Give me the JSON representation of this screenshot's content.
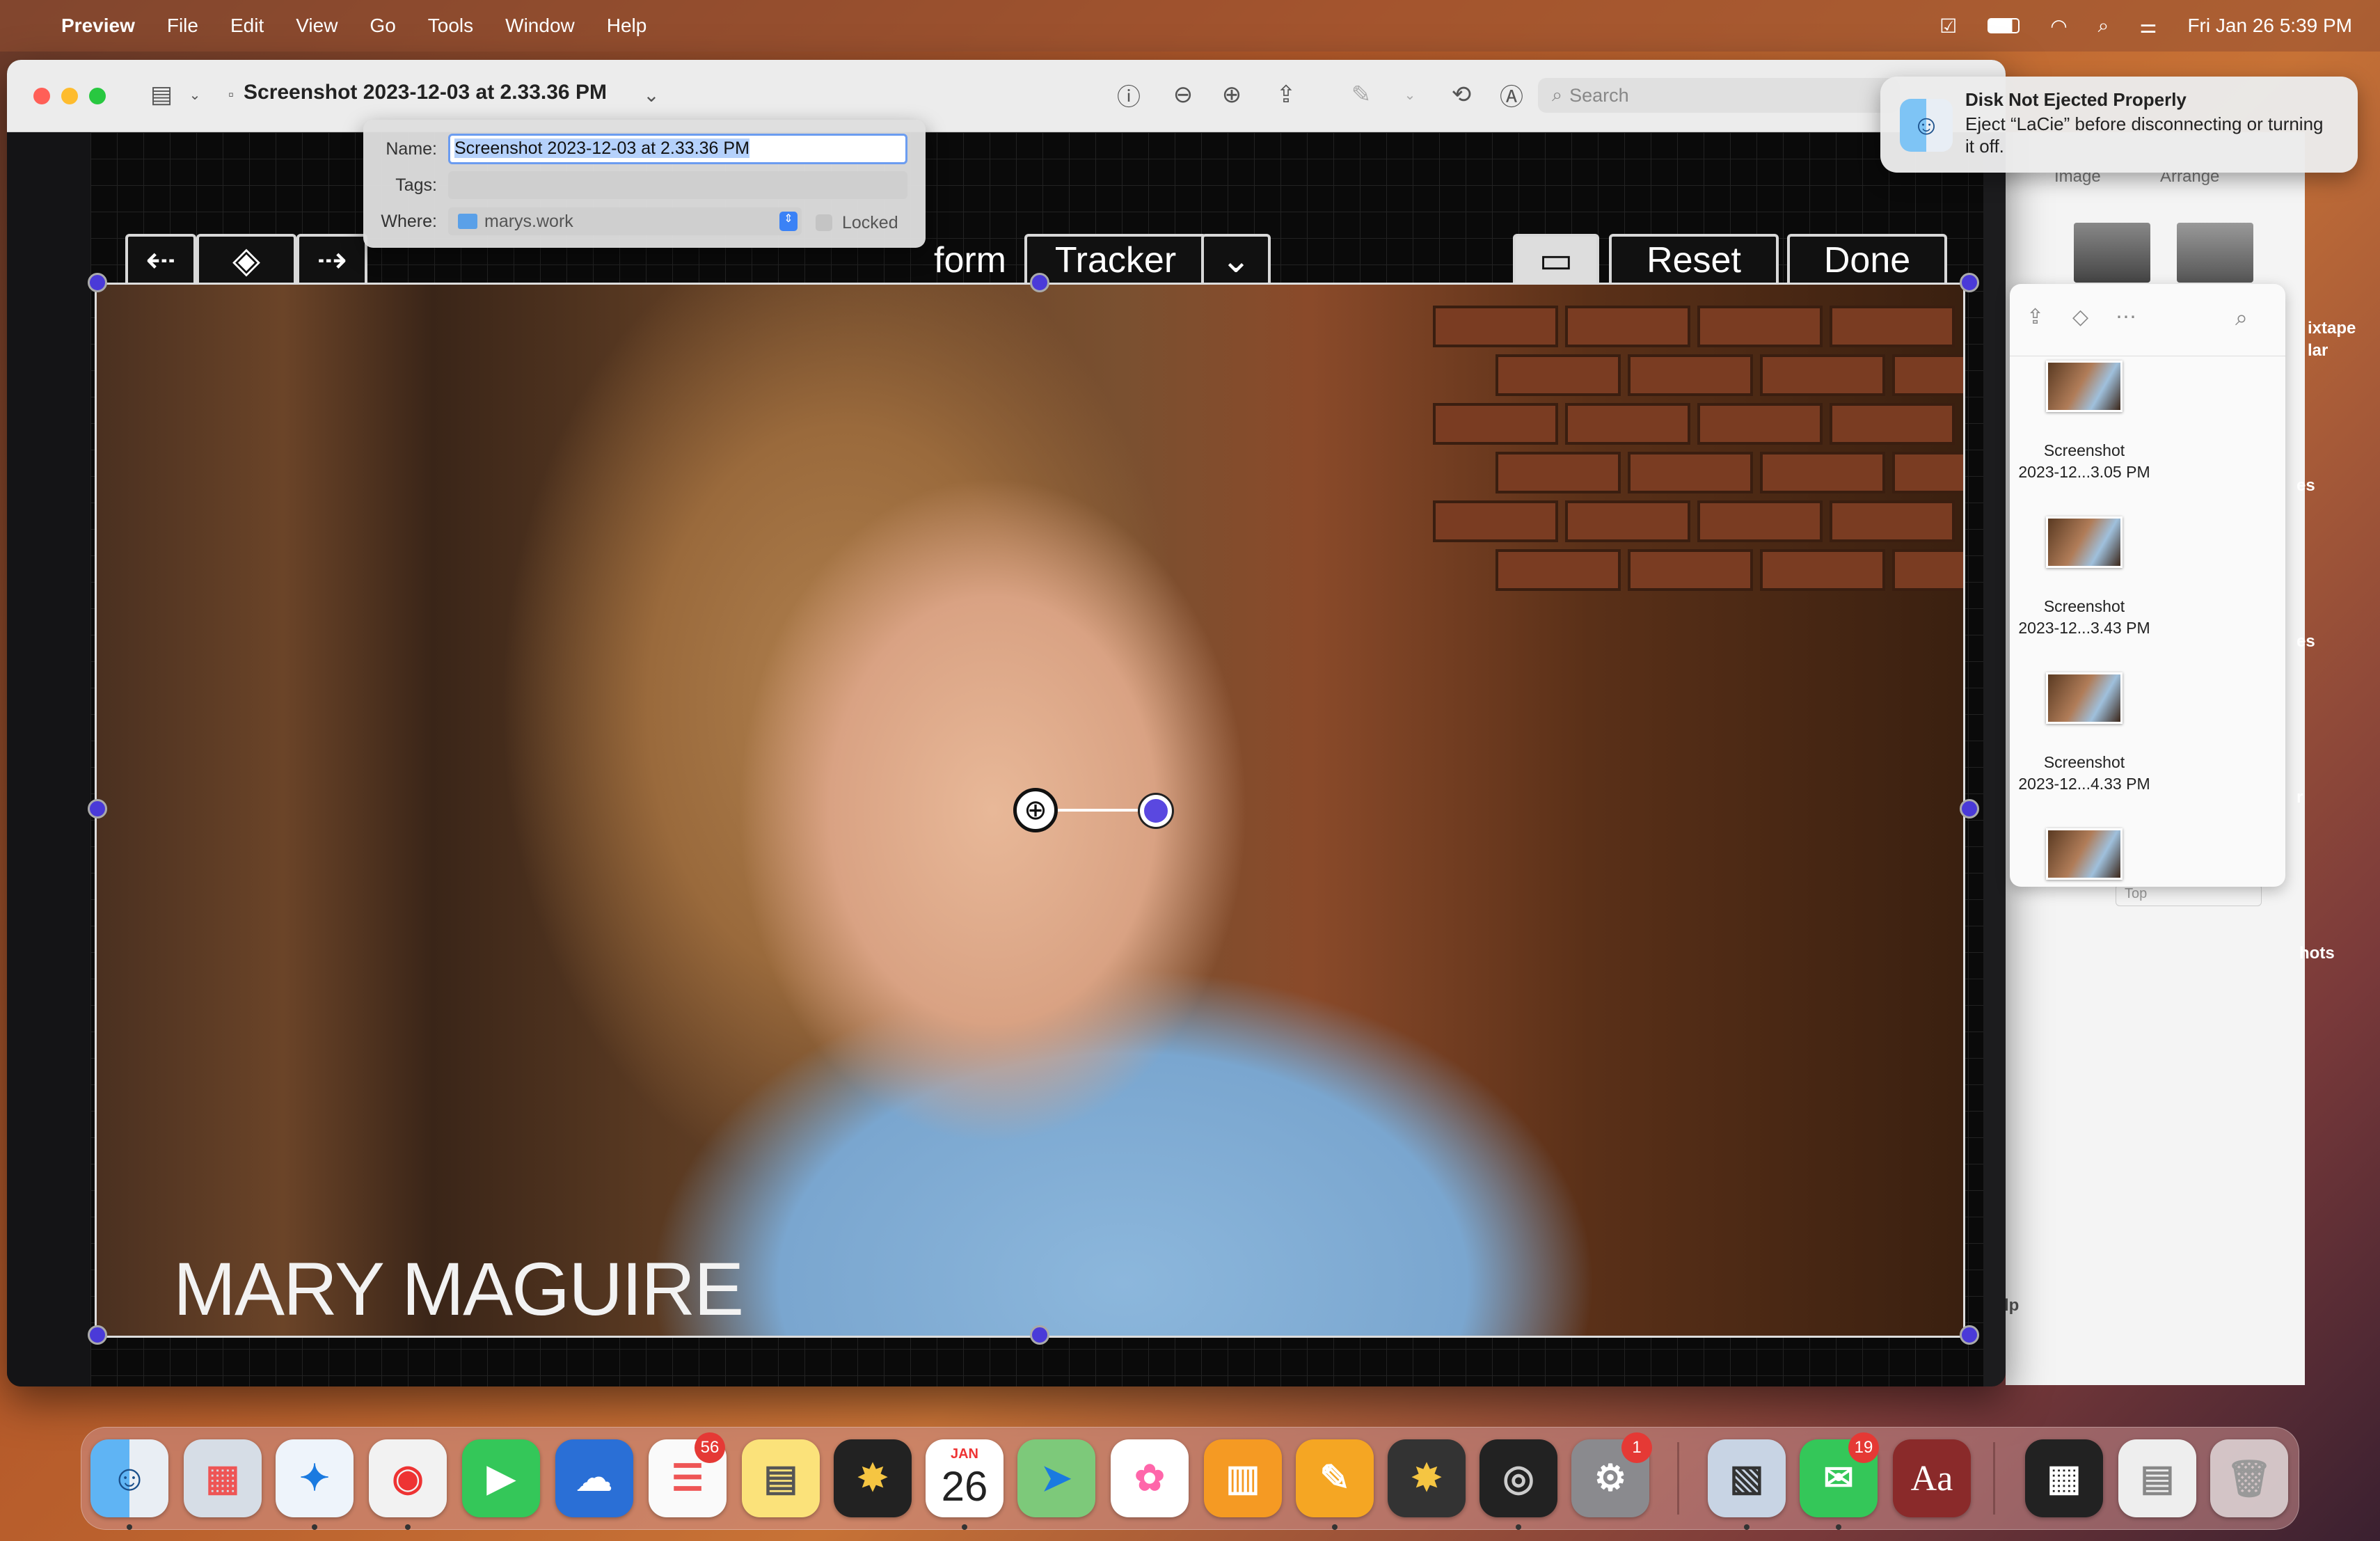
{
  "menubar": {
    "app": "Preview",
    "items": [
      "File",
      "Edit",
      "View",
      "Go",
      "Tools",
      "Window",
      "Help"
    ],
    "datetime": "Fri Jan 26  5:39 PM"
  },
  "window": {
    "title": "Screenshot 2023-12-03 at 2.33.36 PM",
    "search_placeholder": "Search"
  },
  "popover": {
    "name_label": "Name:",
    "name_value": "Screenshot 2023-12-03 at 2.33.36 PM",
    "tags_label": "Tags:",
    "where_label": "Where:",
    "where_value": "marys.work",
    "locked_label": "Locked"
  },
  "overlay": {
    "transform_label": "form",
    "tracker_label": "Tracker",
    "reset_label": "Reset",
    "done_label": "Done"
  },
  "photo": {
    "caption": "MARY MAGUIRE"
  },
  "notification": {
    "title": "Disk Not Ejected Properly",
    "body": "Eject “LaCie” before disconnecting or turning it off."
  },
  "sidepanel": {
    "tabs": [
      "Image",
      "Arrange"
    ],
    "files": [
      {
        "line1": "Screenshot",
        "line2": "2023-12...3.05 PM"
      },
      {
        "line1": "Screenshot",
        "line2": "2023-12...3.43 PM"
      },
      {
        "line1": "Screenshot",
        "line2": "2023-12...4.33 PM"
      }
    ],
    "select_value": "Top"
  },
  "desktop": {
    "labels": [
      "ixtape",
      "lar",
      "es",
      "es",
      "r",
      "hots",
      "lp"
    ]
  },
  "dock": {
    "reminders_badge": "56",
    "calendar_month": "JAN",
    "calendar_day": "26",
    "settings_badge": "1",
    "messages_badge": "19",
    "dictionary_label": "Aa"
  }
}
